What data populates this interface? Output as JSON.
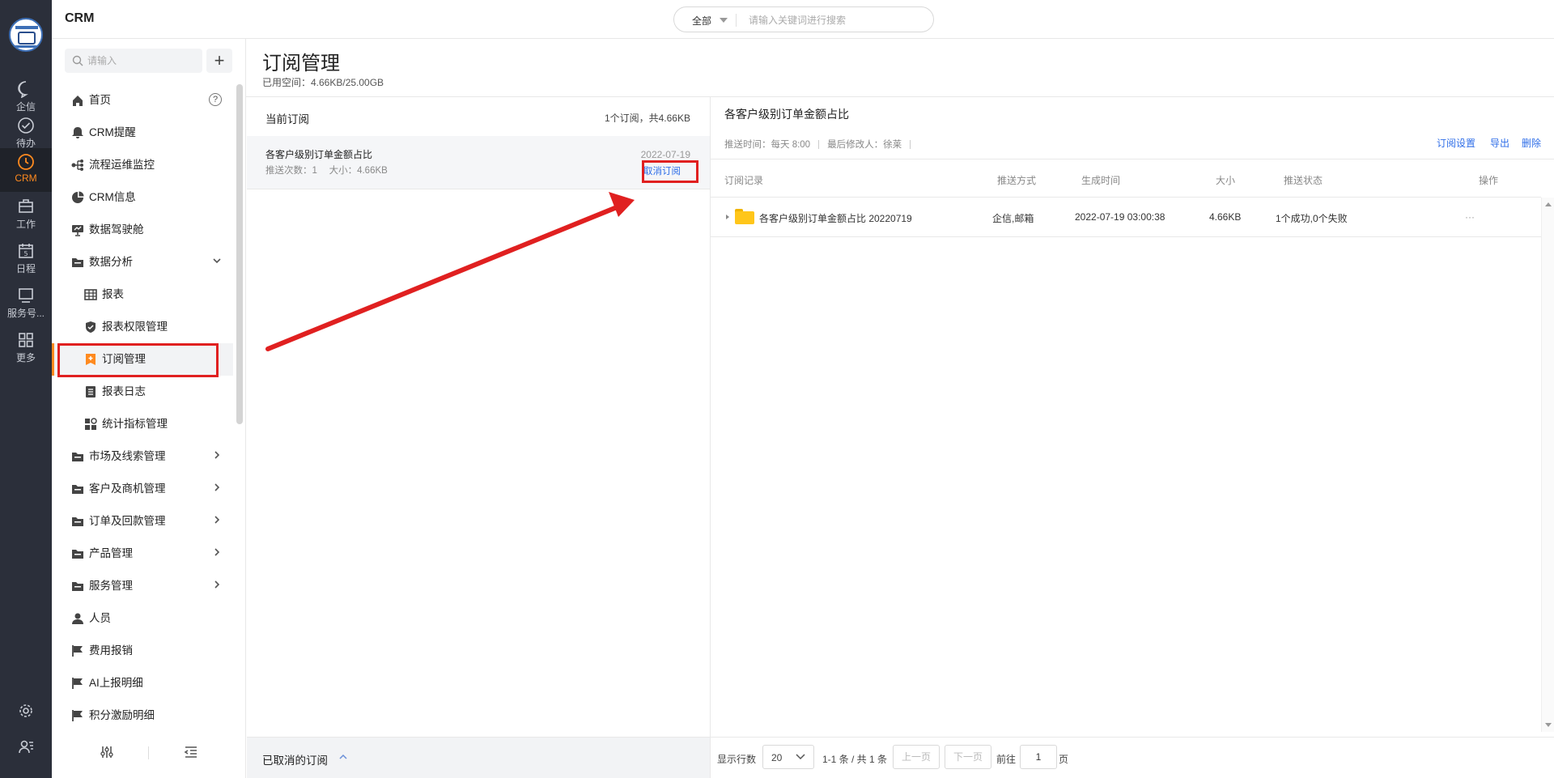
{
  "app": {
    "title": "CRM"
  },
  "rail": {
    "items": [
      {
        "label": "企信",
        "icon": "chat-icon"
      },
      {
        "label": "待办",
        "icon": "check-circle-icon"
      },
      {
        "label": "CRM",
        "icon": "clock-icon",
        "active": true
      },
      {
        "label": "工作",
        "icon": "briefcase-icon"
      },
      {
        "label": "日程",
        "icon": "calendar-icon",
        "badge": "5"
      },
      {
        "label": "服务号...",
        "icon": "monitor-icon"
      },
      {
        "label": "更多",
        "icon": "grid-icon"
      }
    ]
  },
  "search": {
    "scope": "全部",
    "placeholder": "请输入关键词进行搜索"
  },
  "sidebar": {
    "search_placeholder": "请输入",
    "add_label": "+",
    "items": [
      {
        "label": "首页",
        "icon": "home-icon",
        "help": "?"
      },
      {
        "label": "CRM提醒",
        "icon": "bell-icon"
      },
      {
        "label": "流程运维监控",
        "icon": "flow-icon"
      },
      {
        "label": "CRM信息",
        "icon": "pie-icon"
      },
      {
        "label": "数据驾驶舱",
        "icon": "dashboard-icon"
      },
      {
        "label": "数据分析",
        "icon": "folder-icon",
        "expanded": true
      },
      {
        "label": "报表",
        "icon": "table-icon",
        "child": true
      },
      {
        "label": "报表权限管理",
        "icon": "shield-icon",
        "child": true
      },
      {
        "label": "订阅管理",
        "icon": "subscribe-icon",
        "child": true,
        "selected": true
      },
      {
        "label": "报表日志",
        "icon": "list-icon",
        "child": true
      },
      {
        "label": "统计指标管理",
        "icon": "metric-icon",
        "child": true
      },
      {
        "label": "市场及线索管理",
        "icon": "folder-icon",
        "collapsed": true
      },
      {
        "label": "客户及商机管理",
        "icon": "folder-icon",
        "collapsed": true
      },
      {
        "label": "订单及回款管理",
        "icon": "folder-icon",
        "collapsed": true
      },
      {
        "label": "产品管理",
        "icon": "folder-icon",
        "collapsed": true
      },
      {
        "label": "服务管理",
        "icon": "folder-icon",
        "collapsed": true
      },
      {
        "label": "人员",
        "icon": "person-icon"
      },
      {
        "label": "费用报销",
        "icon": "flag-icon"
      },
      {
        "label": "AI上报明细",
        "icon": "flag-icon"
      },
      {
        "label": "积分激励明细",
        "icon": "flag-icon"
      }
    ]
  },
  "page": {
    "title": "订阅管理",
    "storage": "已用空间：4.66KB/25.00GB"
  },
  "current": {
    "title": "当前订阅",
    "count": "1个订阅，共4.66KB",
    "subscription": {
      "name": "各客户级别订单金额占比",
      "meta": "推送次数：1　 大小：4.66KB",
      "date": "2022-07-19",
      "cancel_label": "取消订阅"
    },
    "cancelled_label": "已取消的订阅"
  },
  "detail": {
    "title": "各客户级别订单金额占比",
    "push_time": "推送时间：每天 8:00",
    "modifier": "最后修改人：徐莱",
    "actions": [
      "订阅设置",
      "导出",
      "删除"
    ],
    "columns": [
      "订阅记录",
      "推送方式",
      "生成时间",
      "大小",
      "推送状态",
      "操作"
    ],
    "rows": [
      {
        "record": "各客户级别订单金额占比 20220719",
        "method": "企信,邮箱",
        "time": "2022-07-19 03:00:38",
        "size": "4.66KB",
        "status": "1个成功,0个失败",
        "op": "···"
      }
    ]
  },
  "pager": {
    "rows_label": "显示行数",
    "rows_value": "20",
    "range": "1-1 条 / 共 1 条",
    "prev": "上一页",
    "next": "下一页",
    "goto": "前往",
    "page_value": "1",
    "page_unit": "页"
  },
  "colors": {
    "accent": "#ff8a1f",
    "link": "#2f6ee8",
    "rail": "#2b2f3a",
    "annotation": "#e02020"
  }
}
